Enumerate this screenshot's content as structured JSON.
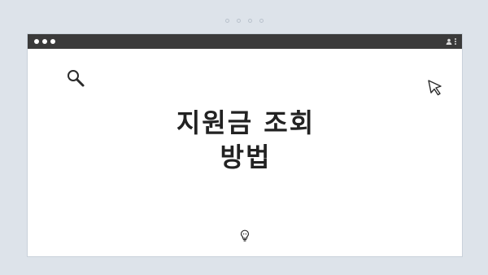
{
  "pager": {
    "dots": 4
  },
  "window": {
    "titlebar": {
      "controls": [
        "close",
        "minimize",
        "maximize"
      ],
      "right_icons": [
        "user-icon",
        "kebab-menu-icon"
      ]
    }
  },
  "slide": {
    "title_line1": "지원금 조회",
    "title_line2": "방법",
    "icons": [
      "search-icon",
      "cursor-icon",
      "lightbulb-icon"
    ]
  },
  "colors": {
    "background": "#dde3ea",
    "titlebar": "#3a3a3a",
    "text": "#222222"
  }
}
